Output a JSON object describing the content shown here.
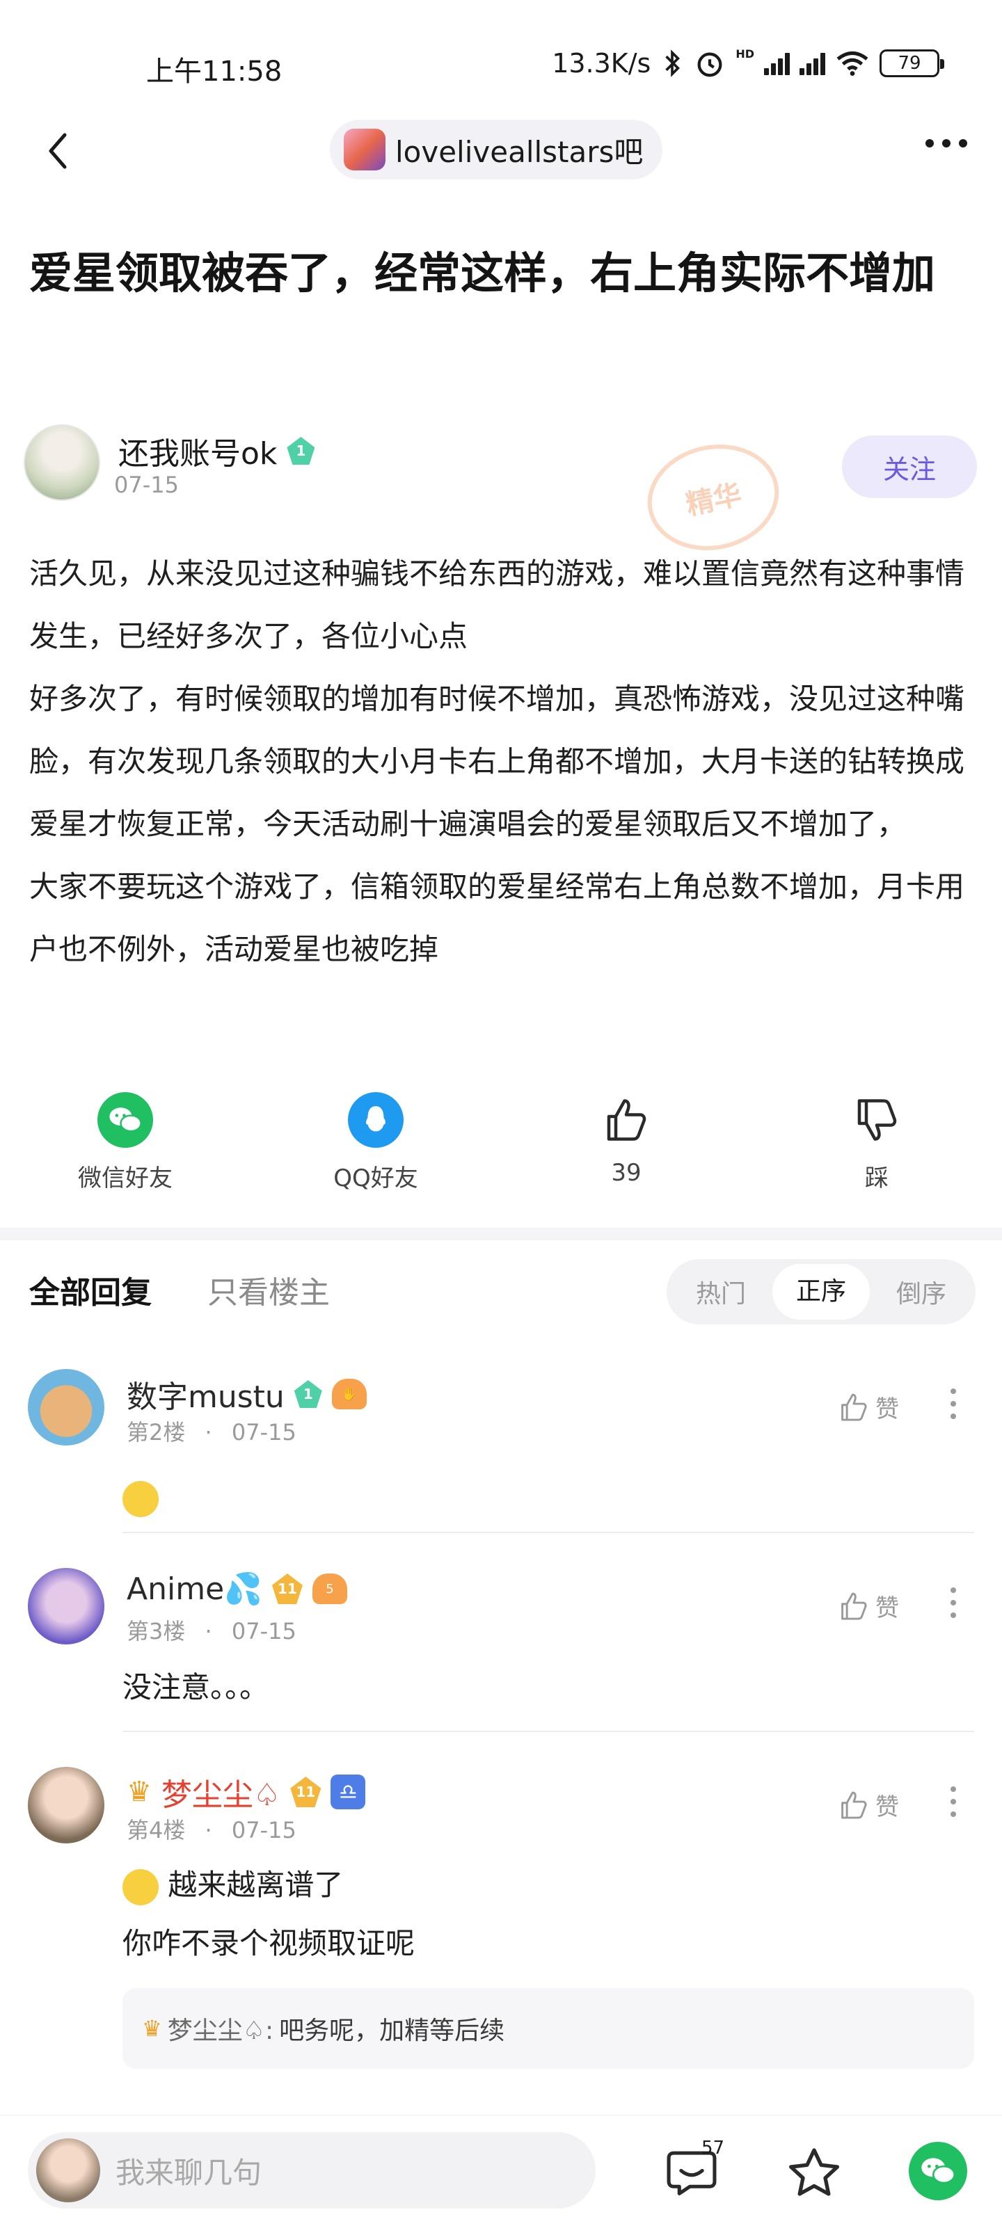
{
  "status_bar": {
    "time": "上午11:58",
    "net_speed": "13.3K/s",
    "hd_label": "HD",
    "battery": "79"
  },
  "nav": {
    "forum_name": "loveliveallstars吧"
  },
  "post": {
    "title": "爱星领取被吞了，经常这样，右上角实际不增加",
    "author": {
      "name": "还我账号ok",
      "level": "1",
      "date": "07-15"
    },
    "follow_label": "关注",
    "stamp_text": "精华",
    "body_paragraphs": [
      "活久见，从来没见过这种骗钱不给东西的游戏，难以置信竟然有这种事情发生，已经好多次了，各位小心点",
      "好多次了，有时候领取的增加有时候不增加，真恐怖游戏，没见过这种嘴脸，有次发现几条领取的大小月卡右上角都不增加，大月卡送的钻转换成爱星才恢复正常，今天活动刷十遍演唱会的爱星领取后又不增加了，",
      "大家不要玩这个游戏了，信箱领取的爱星经常右上角总数不增加，月卡用户也不例外，活动爱星也被吃掉"
    ]
  },
  "share": {
    "wechat": "微信好友",
    "qq": "QQ好友",
    "likes": "39",
    "dislike": "踩"
  },
  "replies_header": {
    "all": "全部回复",
    "owner_only": "只看楼主",
    "sort_hot": "热门",
    "sort_asc": "正序",
    "sort_desc": "倒序"
  },
  "comments": [
    {
      "name": "数字mustu",
      "level": "1",
      "floor": "第2楼",
      "date": "07-15",
      "like_label": "赞",
      "text": ""
    },
    {
      "name": "Anime💦",
      "level": "11",
      "hand_level": "5",
      "floor": "第3楼",
      "date": "07-15",
      "like_label": "赞",
      "text": "没注意。。。"
    },
    {
      "name": "梦尘尘♤",
      "level": "11",
      "floor": "第4楼",
      "date": "07-15",
      "like_label": "赞",
      "line1": "越来越离谱了",
      "line2": "你咋不录个视频取证呢",
      "sub_reply_name": "梦尘尘♤:",
      "sub_reply_text": "吧务呢，加精等后续"
    }
  ],
  "bottom_bar": {
    "placeholder": "我来聊几句",
    "comment_count": "57"
  },
  "colors": {
    "accent": "#6a5ae0",
    "wechat_green": "#1fbf62",
    "qq_blue": "#1e9bf0",
    "vip_red": "#e5412f"
  }
}
